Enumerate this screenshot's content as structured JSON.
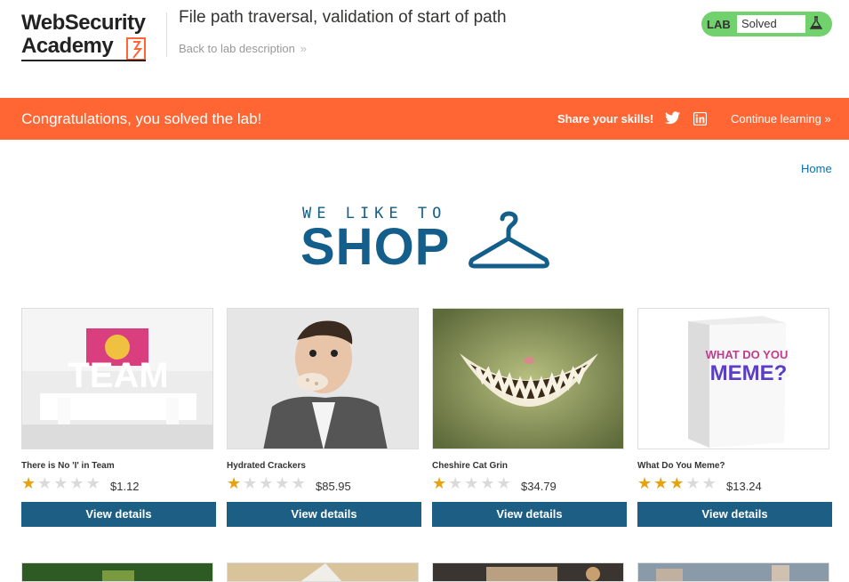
{
  "header": {
    "logo_line1": "WebSecurity",
    "logo_line2": "Academy",
    "lab_title": "File path traversal, validation of start of path",
    "back_link": "Back to lab description",
    "status_label": "LAB",
    "status_value": "Solved"
  },
  "banner": {
    "message": "Congratulations, you solved the lab!",
    "share_label": "Share your skills!",
    "continue_label": "Continue learning"
  },
  "nav": {
    "home": "Home"
  },
  "hero": {
    "tagline": "WE LIKE TO",
    "title": "SHOP"
  },
  "products": [
    {
      "name": "There is No 'I' in Team",
      "price": "$1.12",
      "rating": 1,
      "button": "View details",
      "image_icon": "team-image"
    },
    {
      "name": "Hydrated Crackers",
      "price": "$85.95",
      "rating": 1,
      "button": "View details",
      "image_icon": "crackers-image"
    },
    {
      "name": "Cheshire Cat Grin",
      "price": "$34.79",
      "rating": 1,
      "button": "View details",
      "image_icon": "cat-grin-image"
    },
    {
      "name": "What Do You Meme?",
      "price": "$13.24",
      "rating": 3,
      "button": "View details",
      "image_icon": "meme-game-image"
    }
  ],
  "colors": {
    "accent": "#ff6633",
    "button": "#1d5e84",
    "solved": "#70d16d",
    "brand": "#135e8a"
  }
}
